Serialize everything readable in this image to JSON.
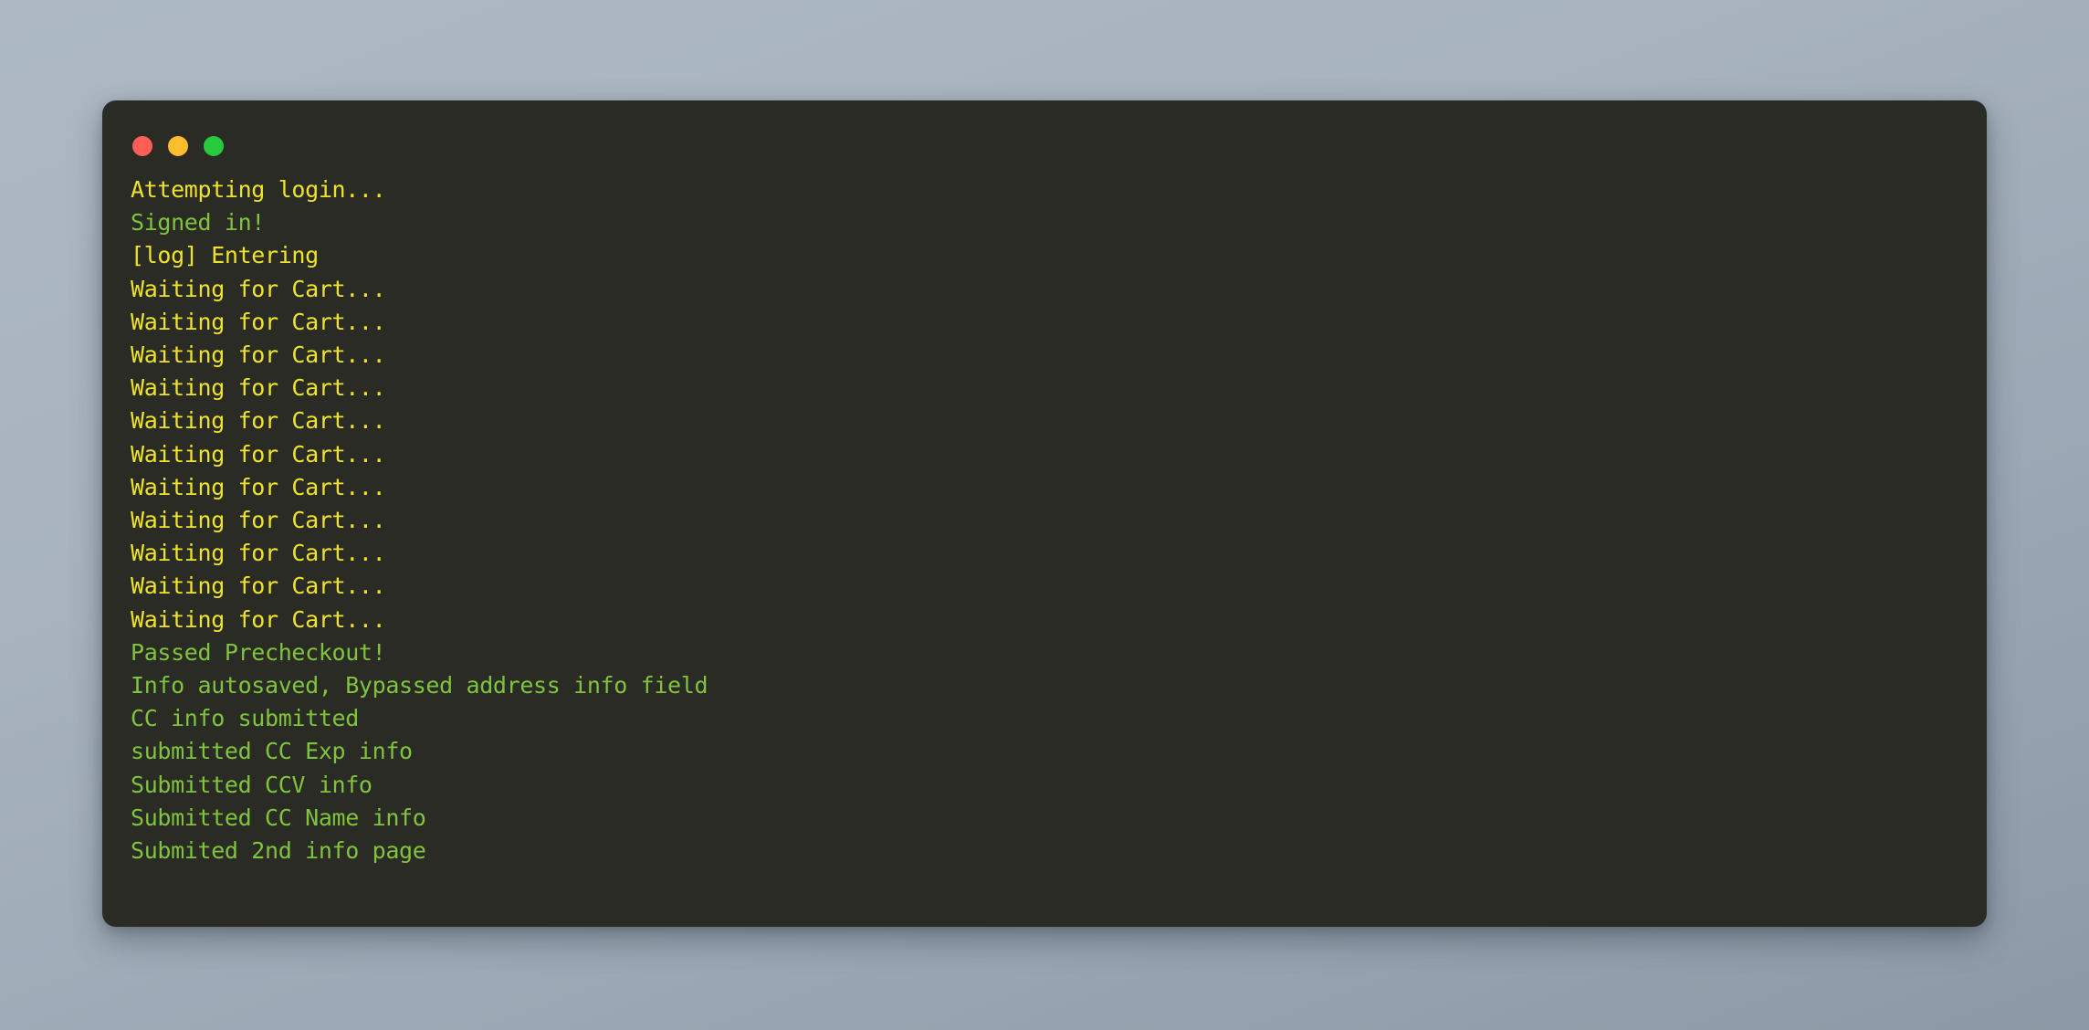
{
  "window": {
    "title": "",
    "background_color": "#2b2b26",
    "traffic_lights": [
      {
        "name": "close",
        "color": "#ff5f56"
      },
      {
        "name": "minimize",
        "color": "#ffbd2e"
      },
      {
        "name": "maximize",
        "color": "#27c93f"
      }
    ]
  },
  "page": {
    "background_top_color": "#adb8c4",
    "background_bottom_color": "#8d99a6"
  },
  "colors": {
    "yellow": "#ede32b",
    "green": "#7fc43c"
  },
  "console": {
    "lines": [
      {
        "text": "Attempting login...",
        "color": "yellow"
      },
      {
        "text": "Signed in!",
        "color": "green"
      },
      {
        "text": "[log] Entering",
        "color": "yellow"
      },
      {
        "text": "Waiting for Cart...",
        "color": "yellow"
      },
      {
        "text": "Waiting for Cart...",
        "color": "yellow"
      },
      {
        "text": "Waiting for Cart...",
        "color": "yellow"
      },
      {
        "text": "Waiting for Cart...",
        "color": "yellow"
      },
      {
        "text": "Waiting for Cart...",
        "color": "yellow"
      },
      {
        "text": "Waiting for Cart...",
        "color": "yellow"
      },
      {
        "text": "Waiting for Cart...",
        "color": "yellow"
      },
      {
        "text": "Waiting for Cart...",
        "color": "yellow"
      },
      {
        "text": "Waiting for Cart...",
        "color": "yellow"
      },
      {
        "text": "Waiting for Cart...",
        "color": "yellow"
      },
      {
        "text": "Waiting for Cart...",
        "color": "yellow"
      },
      {
        "text": "Passed Precheckout!",
        "color": "green"
      },
      {
        "text": "Info autosaved, Bypassed address info field",
        "color": "green"
      },
      {
        "text": "CC info submitted",
        "color": "green"
      },
      {
        "text": "submitted CC Exp info",
        "color": "green"
      },
      {
        "text": "Submitted CCV info",
        "color": "green"
      },
      {
        "text": "Submitted CC Name info",
        "color": "green"
      },
      {
        "text": "Submited 2nd info page",
        "color": "green"
      }
    ]
  }
}
